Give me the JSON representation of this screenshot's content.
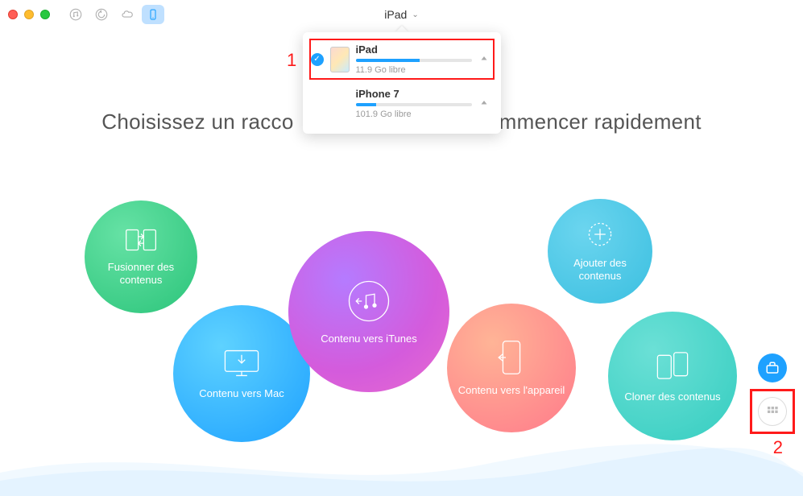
{
  "titlebar": {
    "device_label": "iPad"
  },
  "dropdown": {
    "devices": [
      {
        "name": "iPad",
        "free": "11.9 Go libre",
        "used_pct": 55,
        "selected": true,
        "highlighted": true
      },
      {
        "name": "iPhone 7",
        "free": "101.9 Go libre",
        "used_pct": 18,
        "selected": false,
        "highlighted": false
      }
    ]
  },
  "annotations": {
    "one": "1",
    "two": "2"
  },
  "heading_full": "Choisissez un raccourci afin de commencer rapidement",
  "heading_left": "Choisissez un racco",
  "heading_right": "mmencer rapidement",
  "circles": {
    "fusion": "Fusionner des contenus",
    "mac": "Contenu vers Mac",
    "itunes": "Contenu vers iTunes",
    "device": "Contenu vers l'appareil",
    "add": "Ajouter des contenus",
    "clone": "Cloner des contenus"
  }
}
